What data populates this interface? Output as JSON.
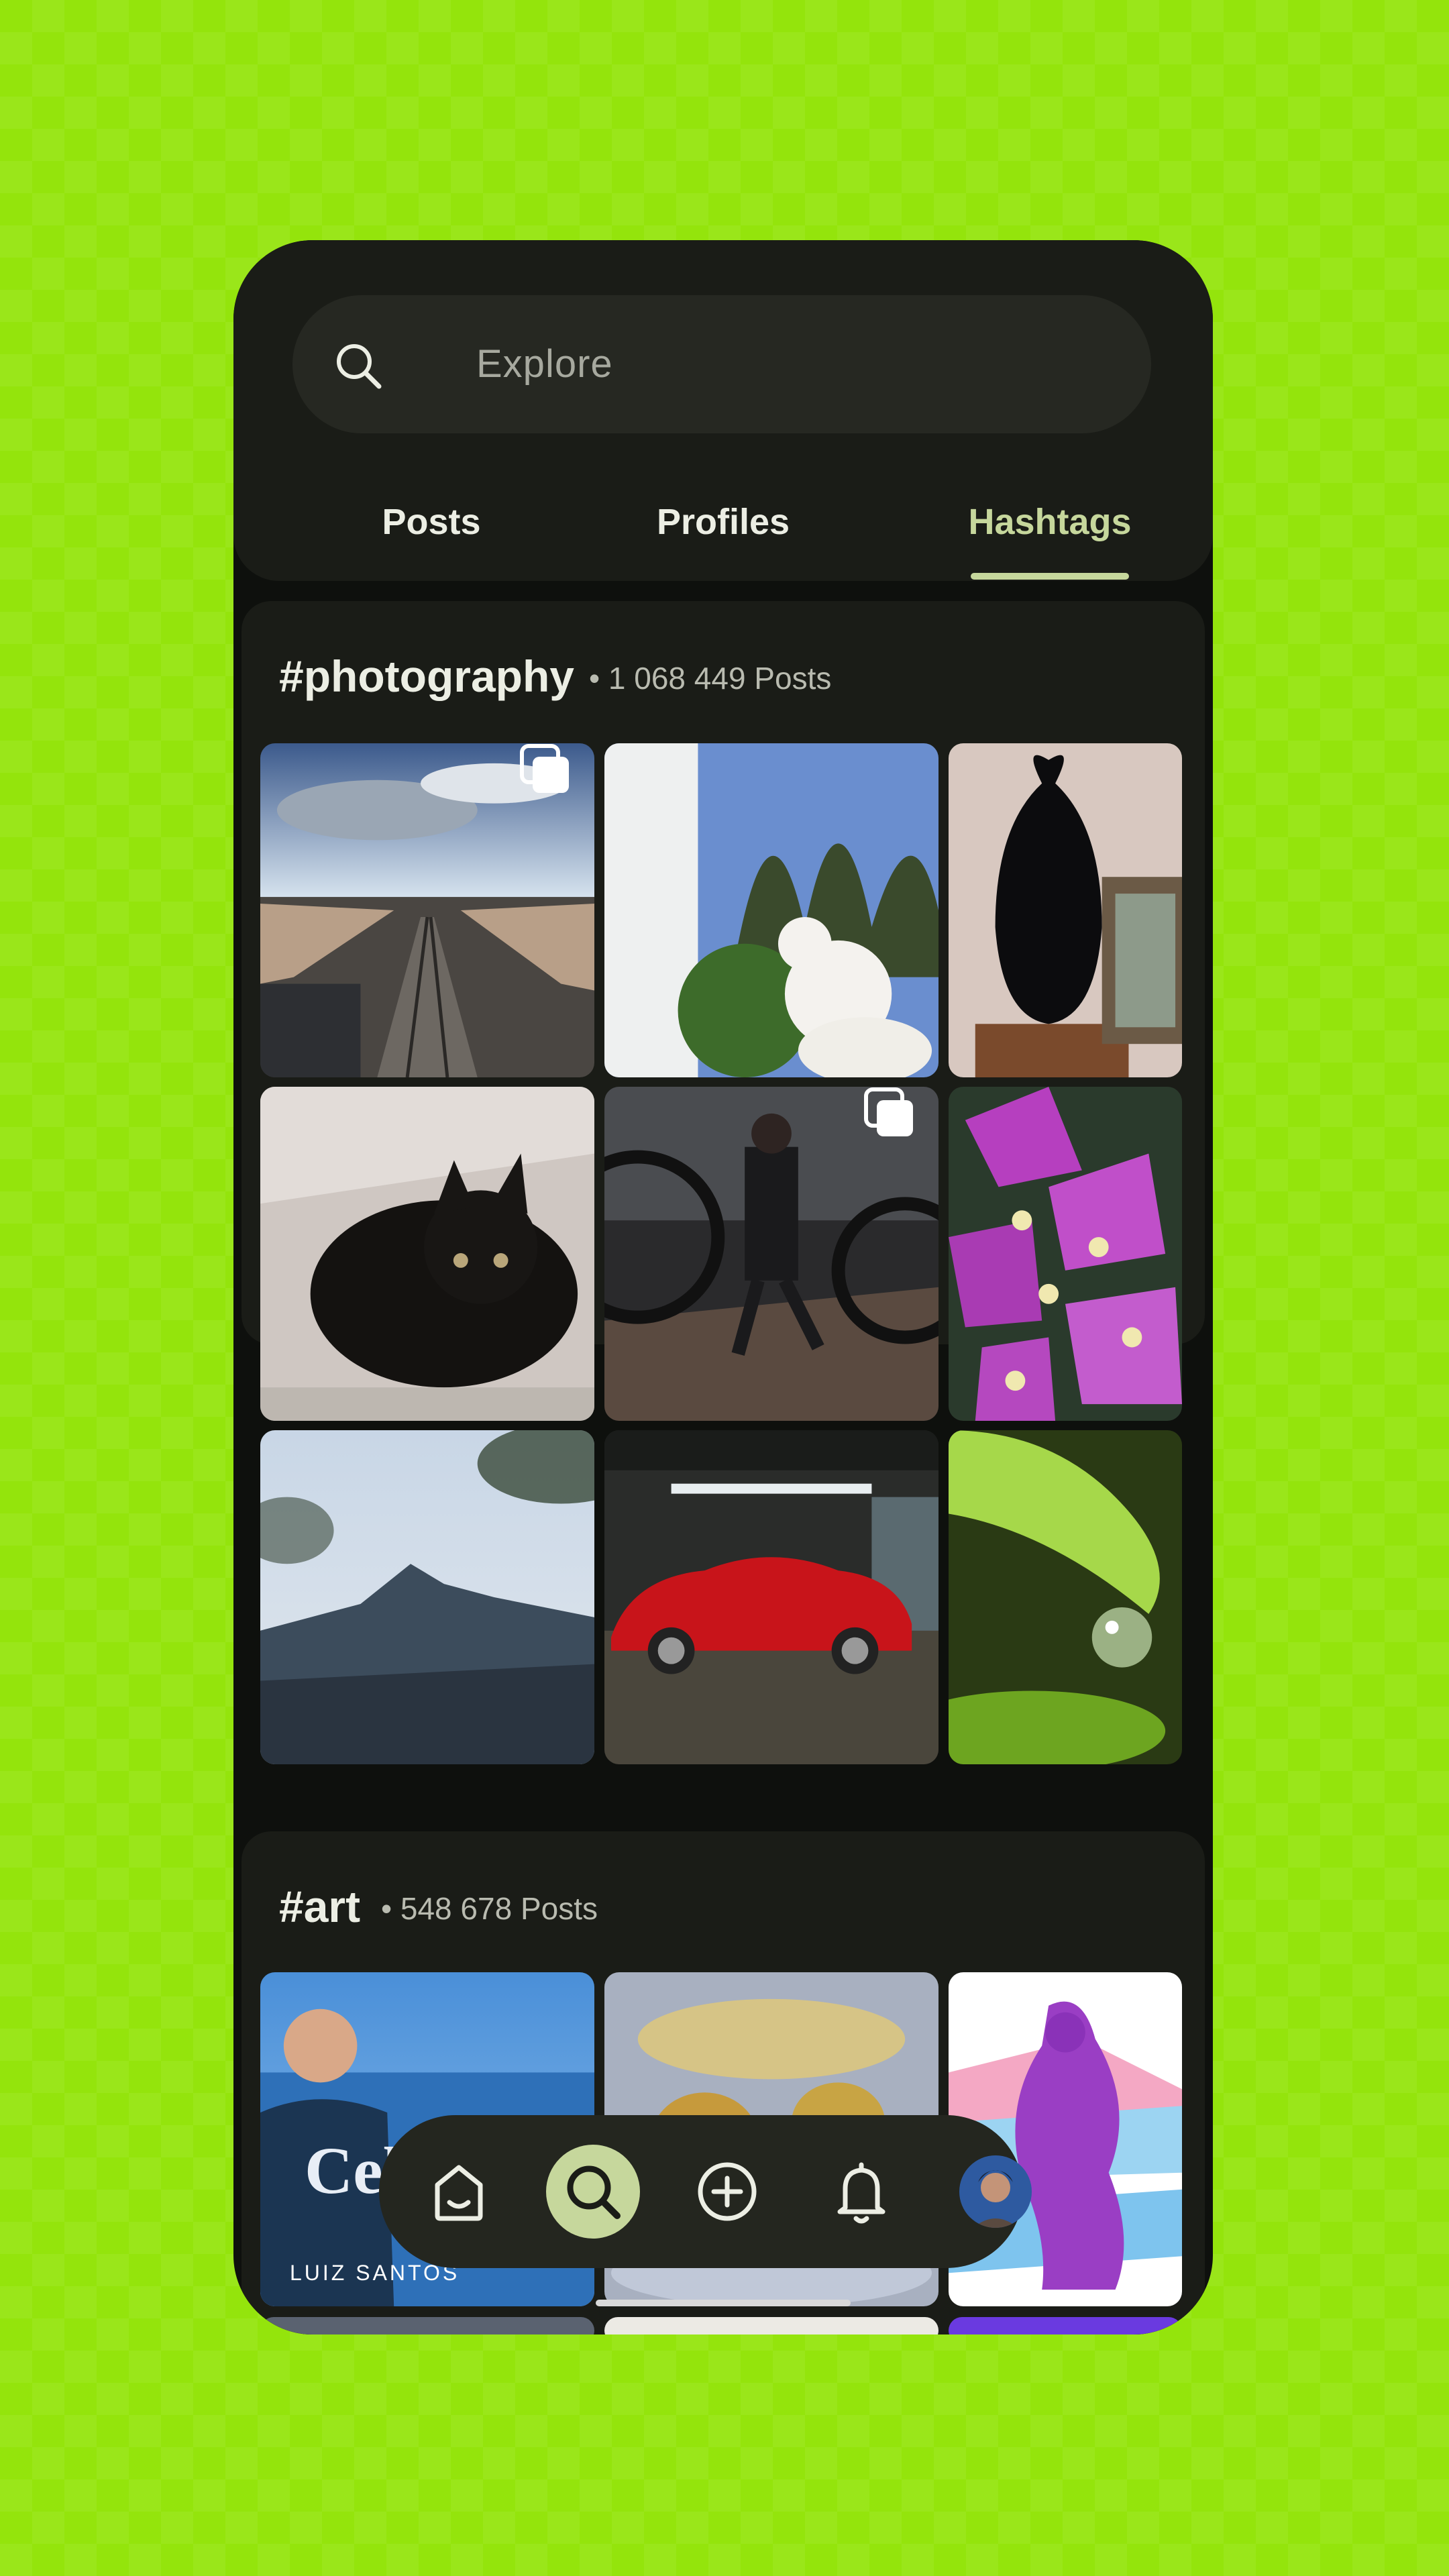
{
  "search": {
    "placeholder": "Explore",
    "icon": "search-icon"
  },
  "tabs": [
    {
      "label": "Posts",
      "active": false
    },
    {
      "label": "Profiles",
      "active": false
    },
    {
      "label": "Hashtags",
      "active": true
    }
  ],
  "hashtags": [
    {
      "tag": "#photography",
      "count": "• 1 068 449 Posts"
    },
    {
      "tag": "#art",
      "count": "• 548 678 Posts"
    }
  ],
  "art_post_1": {
    "overlay_text": "Cel",
    "author_caption": "LUIZ SANTOS"
  },
  "bottom_nav": [
    {
      "id": "home",
      "icon": "home-icon",
      "active": false
    },
    {
      "id": "explore",
      "icon": "search-icon",
      "active": true
    },
    {
      "id": "create",
      "icon": "add-circle-icon",
      "active": false
    },
    {
      "id": "notifications",
      "icon": "bell-icon",
      "active": false
    },
    {
      "id": "profile",
      "icon": "avatar",
      "active": false
    }
  ],
  "colors": {
    "background": "#94e40c",
    "surface": "#1a1c17",
    "accent": "#c6d79c",
    "text": "#eceee4"
  }
}
